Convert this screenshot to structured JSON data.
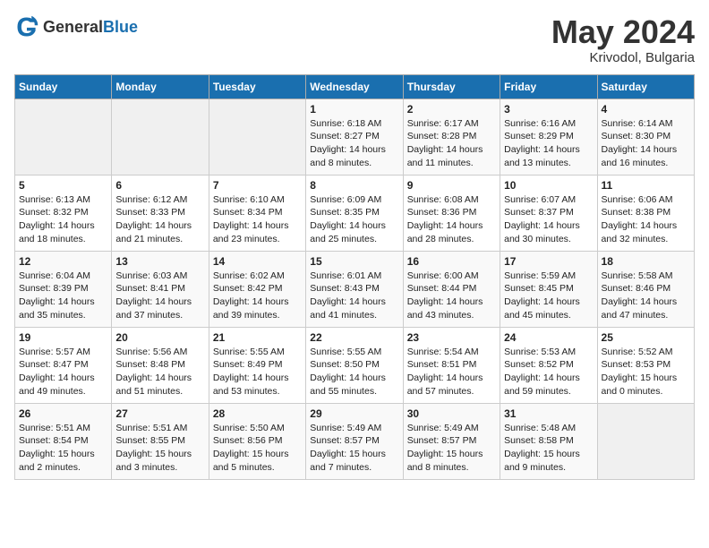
{
  "header": {
    "logo_general": "General",
    "logo_blue": "Blue",
    "month_year": "May 2024",
    "location": "Krivodol, Bulgaria"
  },
  "days_of_week": [
    "Sunday",
    "Monday",
    "Tuesday",
    "Wednesday",
    "Thursday",
    "Friday",
    "Saturday"
  ],
  "weeks": [
    [
      {
        "day": "",
        "info": ""
      },
      {
        "day": "",
        "info": ""
      },
      {
        "day": "",
        "info": ""
      },
      {
        "day": "1",
        "info": "Sunrise: 6:18 AM\nSunset: 8:27 PM\nDaylight: 14 hours\nand 8 minutes."
      },
      {
        "day": "2",
        "info": "Sunrise: 6:17 AM\nSunset: 8:28 PM\nDaylight: 14 hours\nand 11 minutes."
      },
      {
        "day": "3",
        "info": "Sunrise: 6:16 AM\nSunset: 8:29 PM\nDaylight: 14 hours\nand 13 minutes."
      },
      {
        "day": "4",
        "info": "Sunrise: 6:14 AM\nSunset: 8:30 PM\nDaylight: 14 hours\nand 16 minutes."
      }
    ],
    [
      {
        "day": "5",
        "info": "Sunrise: 6:13 AM\nSunset: 8:32 PM\nDaylight: 14 hours\nand 18 minutes."
      },
      {
        "day": "6",
        "info": "Sunrise: 6:12 AM\nSunset: 8:33 PM\nDaylight: 14 hours\nand 21 minutes."
      },
      {
        "day": "7",
        "info": "Sunrise: 6:10 AM\nSunset: 8:34 PM\nDaylight: 14 hours\nand 23 minutes."
      },
      {
        "day": "8",
        "info": "Sunrise: 6:09 AM\nSunset: 8:35 PM\nDaylight: 14 hours\nand 25 minutes."
      },
      {
        "day": "9",
        "info": "Sunrise: 6:08 AM\nSunset: 8:36 PM\nDaylight: 14 hours\nand 28 minutes."
      },
      {
        "day": "10",
        "info": "Sunrise: 6:07 AM\nSunset: 8:37 PM\nDaylight: 14 hours\nand 30 minutes."
      },
      {
        "day": "11",
        "info": "Sunrise: 6:06 AM\nSunset: 8:38 PM\nDaylight: 14 hours\nand 32 minutes."
      }
    ],
    [
      {
        "day": "12",
        "info": "Sunrise: 6:04 AM\nSunset: 8:39 PM\nDaylight: 14 hours\nand 35 minutes."
      },
      {
        "day": "13",
        "info": "Sunrise: 6:03 AM\nSunset: 8:41 PM\nDaylight: 14 hours\nand 37 minutes."
      },
      {
        "day": "14",
        "info": "Sunrise: 6:02 AM\nSunset: 8:42 PM\nDaylight: 14 hours\nand 39 minutes."
      },
      {
        "day": "15",
        "info": "Sunrise: 6:01 AM\nSunset: 8:43 PM\nDaylight: 14 hours\nand 41 minutes."
      },
      {
        "day": "16",
        "info": "Sunrise: 6:00 AM\nSunset: 8:44 PM\nDaylight: 14 hours\nand 43 minutes."
      },
      {
        "day": "17",
        "info": "Sunrise: 5:59 AM\nSunset: 8:45 PM\nDaylight: 14 hours\nand 45 minutes."
      },
      {
        "day": "18",
        "info": "Sunrise: 5:58 AM\nSunset: 8:46 PM\nDaylight: 14 hours\nand 47 minutes."
      }
    ],
    [
      {
        "day": "19",
        "info": "Sunrise: 5:57 AM\nSunset: 8:47 PM\nDaylight: 14 hours\nand 49 minutes."
      },
      {
        "day": "20",
        "info": "Sunrise: 5:56 AM\nSunset: 8:48 PM\nDaylight: 14 hours\nand 51 minutes."
      },
      {
        "day": "21",
        "info": "Sunrise: 5:55 AM\nSunset: 8:49 PM\nDaylight: 14 hours\nand 53 minutes."
      },
      {
        "day": "22",
        "info": "Sunrise: 5:55 AM\nSunset: 8:50 PM\nDaylight: 14 hours\nand 55 minutes."
      },
      {
        "day": "23",
        "info": "Sunrise: 5:54 AM\nSunset: 8:51 PM\nDaylight: 14 hours\nand 57 minutes."
      },
      {
        "day": "24",
        "info": "Sunrise: 5:53 AM\nSunset: 8:52 PM\nDaylight: 14 hours\nand 59 minutes."
      },
      {
        "day": "25",
        "info": "Sunrise: 5:52 AM\nSunset: 8:53 PM\nDaylight: 15 hours\nand 0 minutes."
      }
    ],
    [
      {
        "day": "26",
        "info": "Sunrise: 5:51 AM\nSunset: 8:54 PM\nDaylight: 15 hours\nand 2 minutes."
      },
      {
        "day": "27",
        "info": "Sunrise: 5:51 AM\nSunset: 8:55 PM\nDaylight: 15 hours\nand 3 minutes."
      },
      {
        "day": "28",
        "info": "Sunrise: 5:50 AM\nSunset: 8:56 PM\nDaylight: 15 hours\nand 5 minutes."
      },
      {
        "day": "29",
        "info": "Sunrise: 5:49 AM\nSunset: 8:57 PM\nDaylight: 15 hours\nand 7 minutes."
      },
      {
        "day": "30",
        "info": "Sunrise: 5:49 AM\nSunset: 8:57 PM\nDaylight: 15 hours\nand 8 minutes."
      },
      {
        "day": "31",
        "info": "Sunrise: 5:48 AM\nSunset: 8:58 PM\nDaylight: 15 hours\nand 9 minutes."
      },
      {
        "day": "",
        "info": ""
      }
    ]
  ]
}
